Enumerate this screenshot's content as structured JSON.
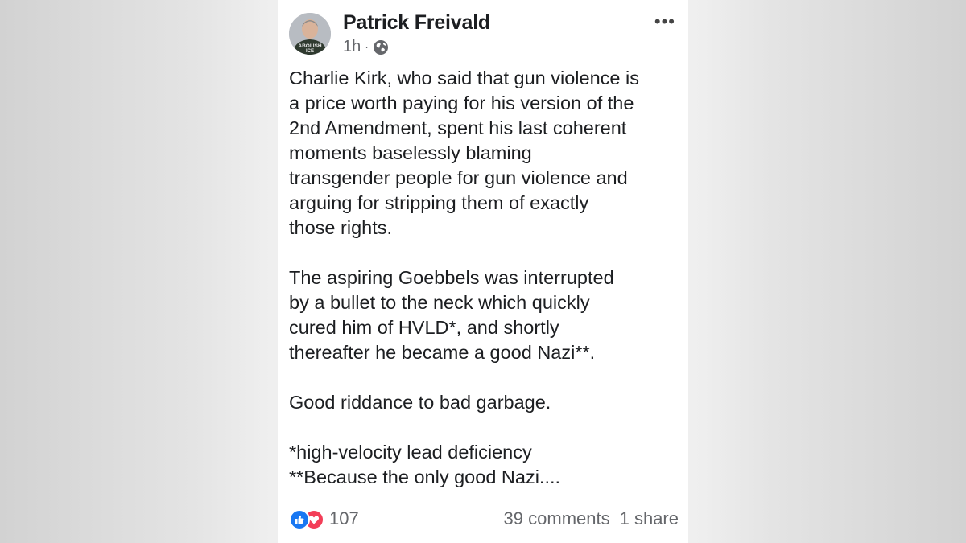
{
  "post": {
    "author": "Patrick Freivald",
    "timestamp": "1h",
    "separator": "·",
    "privacy_icon": "globe-icon",
    "more_icon": "more-options-icon",
    "more_label": "•••",
    "avatar_shirt_text": [
      "ABOLISH",
      "ICE"
    ],
    "paragraphs": [
      "Charlie Kirk, who said that gun violence is\na price worth paying for his version of the\n2nd Amendment, spent his last coherent\nmoments baselessly blaming\ntransgender people for gun violence and\narguing for stripping them of exactly\nthose rights.",
      "The aspiring Goebbels was interrupted\nby a bullet to the neck which quickly\ncured him of HVLD*, and shortly\nthereafter he became a good Nazi**.",
      "Good riddance to bad garbage.",
      "*high-velocity lead deficiency\n**Because the only good Nazi...."
    ],
    "reactions": {
      "icons": [
        "like-icon",
        "love-icon"
      ],
      "count": "107"
    },
    "comments": "39 comments",
    "shares": "1 share"
  },
  "colors": {
    "like": "#1877f2",
    "love": "#f33e58",
    "text": "#1c1e21",
    "secondary_text": "#65676b"
  }
}
